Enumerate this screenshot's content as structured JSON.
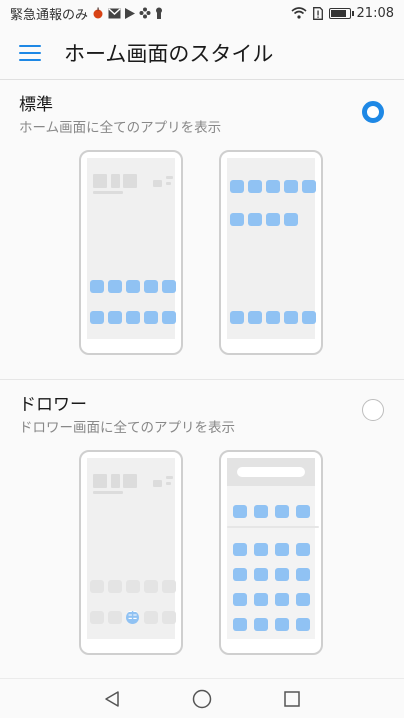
{
  "status_bar": {
    "carrier_text": "緊急通報のみ",
    "time": "21:08",
    "notification_icons": [
      "fruit-icon",
      "mail-icon",
      "play-store-icon",
      "flower-icon",
      "keyhole-icon"
    ],
    "battery_level": 0.9
  },
  "app_bar": {
    "title": "ホーム画面のスタイル",
    "menu_icon": "hamburger-menu-icon",
    "accent_color": "#1e88e5"
  },
  "options": [
    {
      "title": "標準",
      "subtitle": "ホーム画面に全てのアプリを表示",
      "selected": true
    },
    {
      "title": "ドロワー",
      "subtitle": "ドロワー画面に全てのアプリを表示",
      "selected": false
    }
  ],
  "nav_bar": {
    "back_icon": "back-triangle-icon",
    "home_icon": "home-circle-icon",
    "recents_icon": "recents-square-icon"
  }
}
